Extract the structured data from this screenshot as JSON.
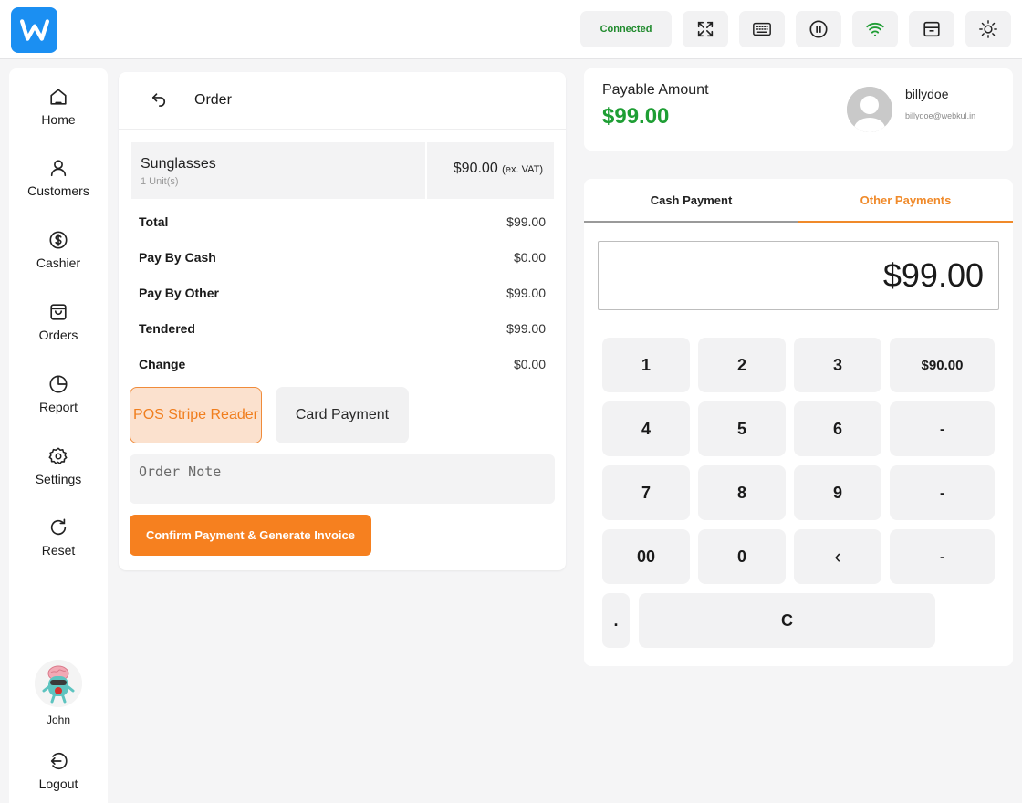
{
  "topbar": {
    "connected_label": "Connected",
    "icons": [
      "expand-icon",
      "keyboard-icon",
      "pause-icon",
      "wifi-icon",
      "drawer-icon",
      "sun-icon"
    ],
    "wifi_color": "#1f9d34"
  },
  "sidebar": {
    "items": [
      {
        "label": "Home",
        "icon": "home-icon"
      },
      {
        "label": "Customers",
        "icon": "user-icon"
      },
      {
        "label": "Cashier",
        "icon": "dollar-icon"
      },
      {
        "label": "Orders",
        "icon": "bag-icon"
      },
      {
        "label": "Report",
        "icon": "pie-chart-icon"
      },
      {
        "label": "Settings",
        "icon": "gear-icon"
      },
      {
        "label": "Reset",
        "icon": "refresh-icon"
      }
    ],
    "user_name": "John",
    "logout_label": "Logout"
  },
  "order": {
    "title": "Order",
    "item": {
      "name": "Sunglasses",
      "units": "1 Unit(s)",
      "price": "$90.00",
      "vat_note": "(ex. VAT)"
    },
    "summary": [
      {
        "label": "Total",
        "value": "$99.00"
      },
      {
        "label": "Pay By Cash",
        "value": "$0.00"
      },
      {
        "label": "Pay By Other",
        "value": "$99.00"
      },
      {
        "label": "Tendered",
        "value": "$99.00"
      },
      {
        "label": "Change",
        "value": "$0.00"
      }
    ],
    "stripe_label": "POS Stripe Reader",
    "card_label": "Card Payment",
    "note_placeholder": "Order Note",
    "confirm_label": "Confirm Payment & Generate Invoice"
  },
  "payable": {
    "label": "Payable Amount",
    "amount": "$99.00",
    "customer_name": "billydoe",
    "customer_email": "billydoe@webkul.in"
  },
  "payment": {
    "tab_cash": "Cash Payment",
    "tab_other": "Other Payments",
    "amount_value": "$99.00",
    "keys": [
      "1",
      "2",
      "3",
      "$90.00",
      "4",
      "5",
      "6",
      "-",
      "7",
      "8",
      "9",
      "-",
      "00",
      "0",
      "‹",
      "-",
      ".",
      "C"
    ]
  },
  "colors": {
    "accent": "#f6801f",
    "success": "#1e9e34",
    "brand": "#1b8ff2"
  }
}
